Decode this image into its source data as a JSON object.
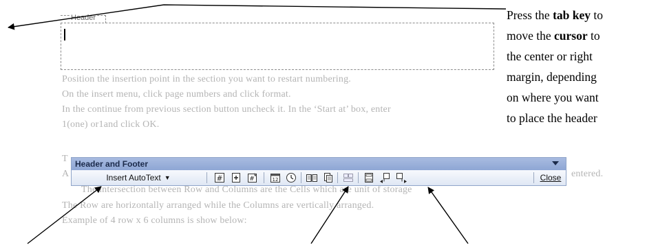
{
  "header_area": {
    "label": "Header"
  },
  "callout": {
    "part1": "Press the ",
    "bold1": "tab key",
    "part2": " to\nmove the ",
    "bold2": "cursor",
    "part3": " to\nthe center or right\nmargin, depending\non where you want\nto place the header"
  },
  "document": {
    "lines": [
      "Position the insertion point in the section you want to restart numbering.",
      "On the insert menu, click page numbers and click format.",
      "In the continue from previous section button uncheck it. In the  ‘Start at’ box, enter",
      "1(one) or1and click OK.",
      "T",
      "A",
      "entered.",
      "The intersection between Row and Columns are the Cells  which are unit of storage",
      "The Row are horizontally arranged while the Columns are vertically arranged.",
      "Example of 4 row  x  6 columns is show below:"
    ]
  },
  "toolbar": {
    "title": "Header and Footer",
    "insert_autotext": "Insert AutoText",
    "close": "Close",
    "icons": [
      "insert-page-number-icon",
      "insert-number-of-pages-icon",
      "format-page-number-icon",
      "insert-date-icon",
      "insert-time-icon",
      "page-setup-icon",
      "show-hide-document-text-icon",
      "same-as-previous-icon",
      "switch-header-footer-icon",
      "show-previous-icon",
      "show-next-icon"
    ]
  },
  "colors": {
    "toolbar_title": "#8ea6d4",
    "toolbar_body": "#e8eef8",
    "faded_text": "#b4b4b4"
  }
}
